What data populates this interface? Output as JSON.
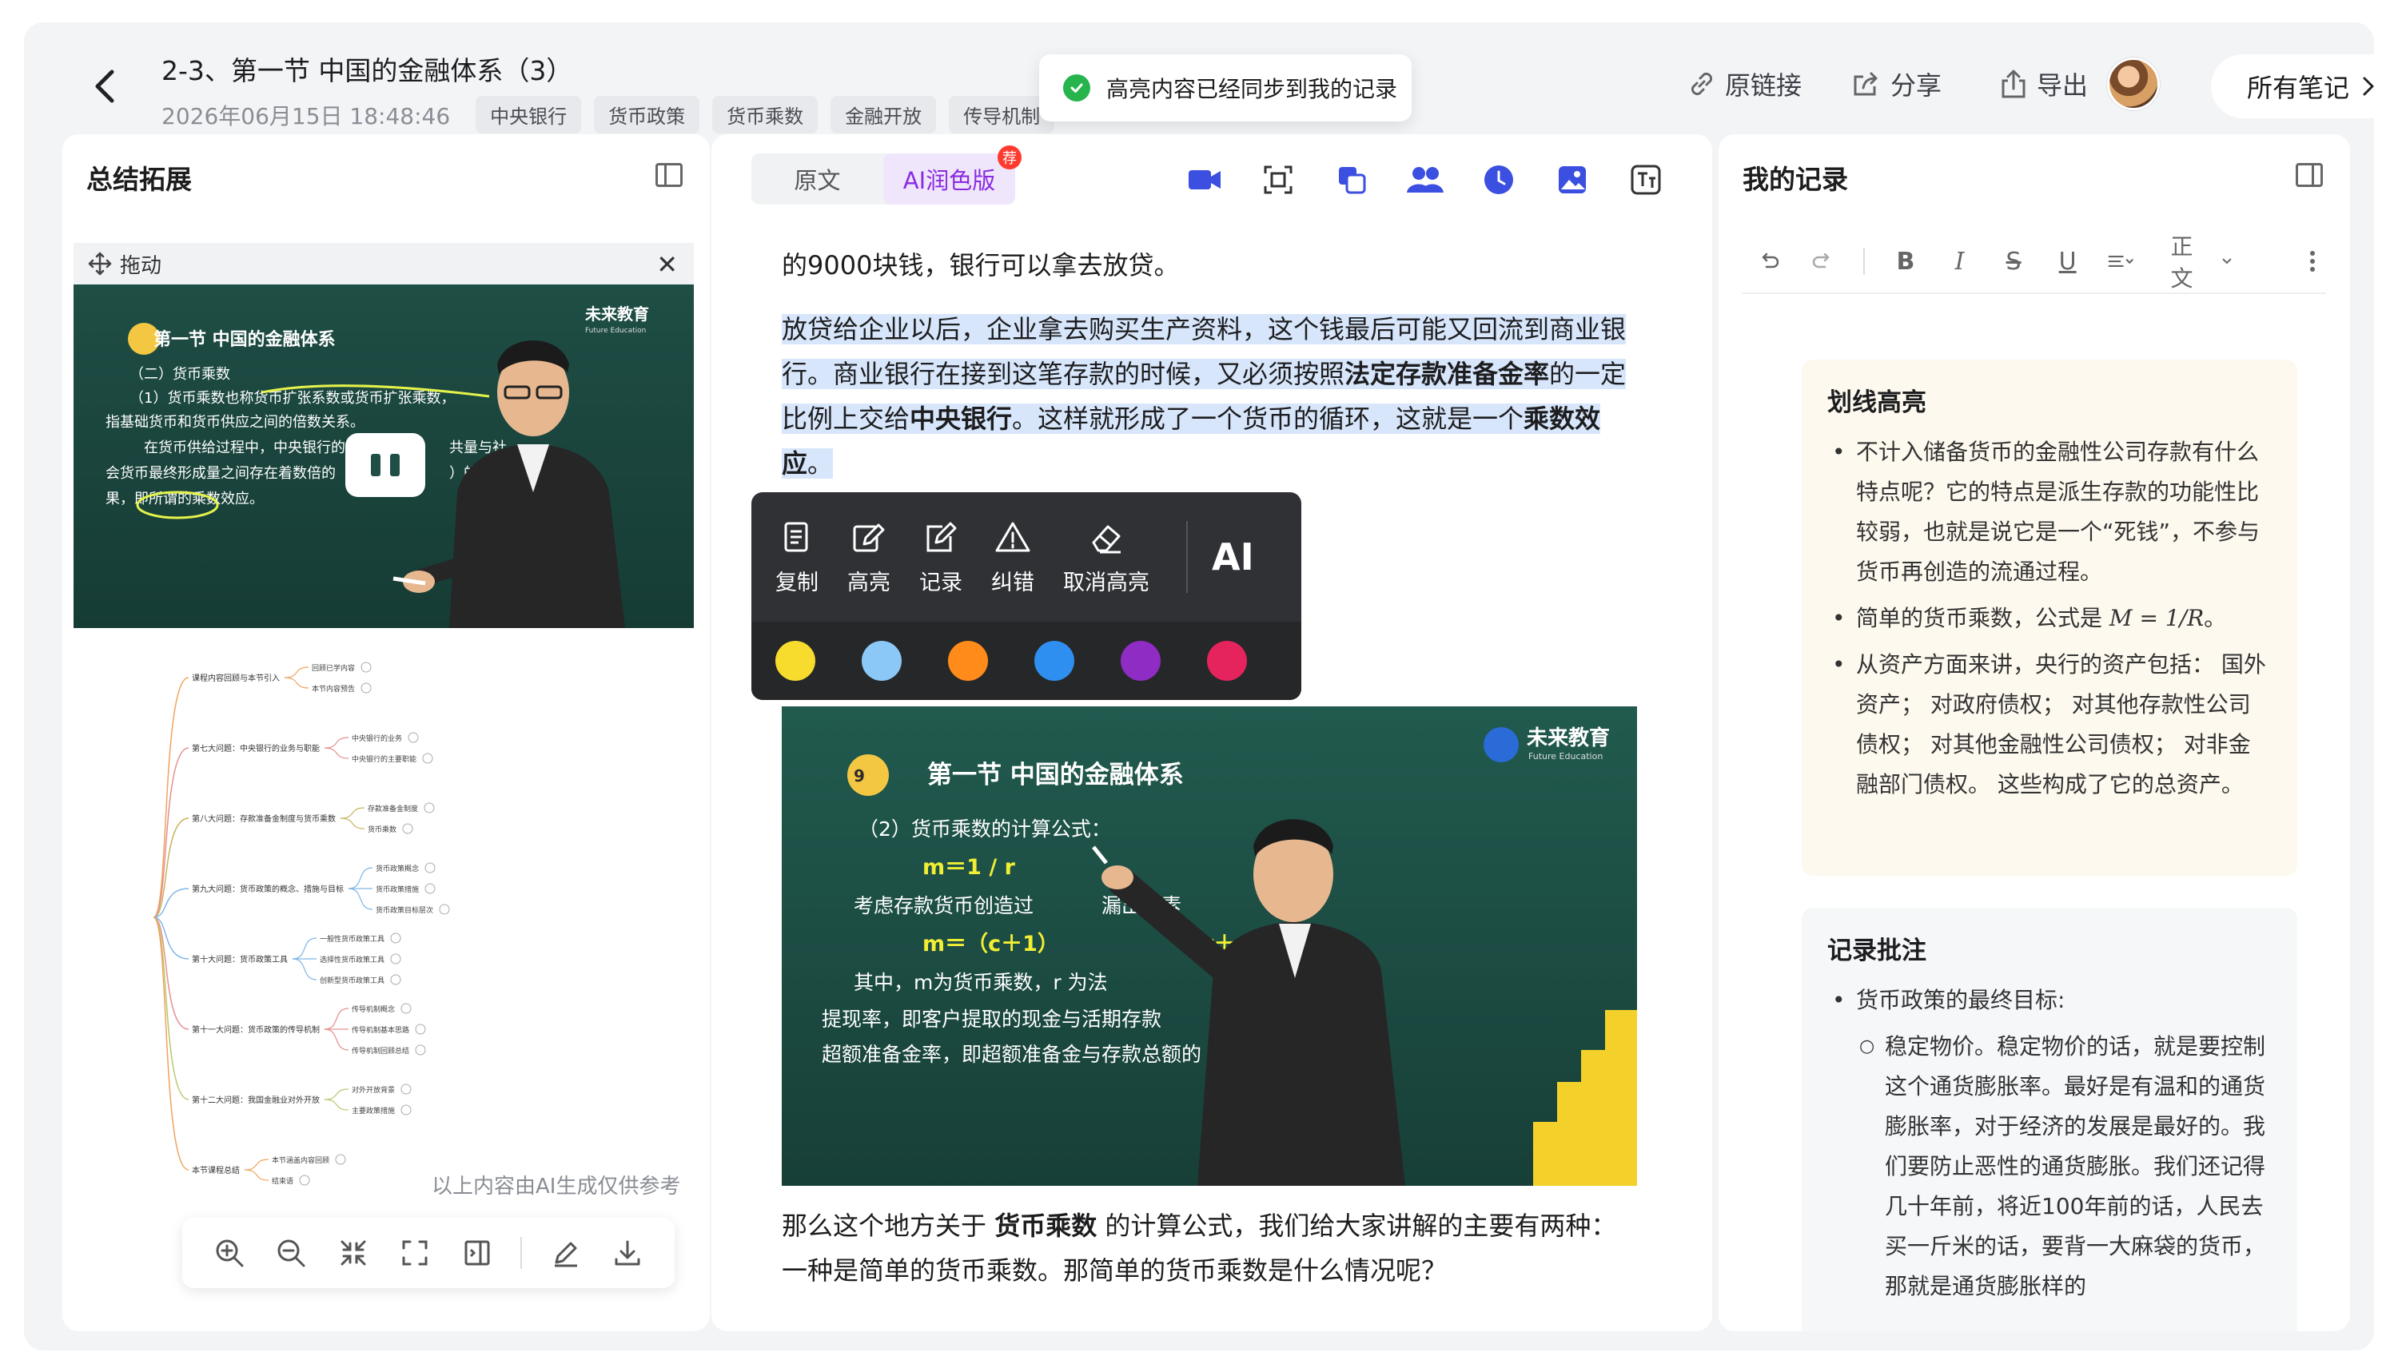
{
  "header": {
    "title": "2-3、第一节 中国的金融体系（3）",
    "date": "2026年06月15日 18:48:46",
    "tags": [
      "中央银行",
      "货币政策",
      "货币乘数",
      "金融开放",
      "传导机制"
    ],
    "toast": "高亮内容已经同步到我的记录",
    "link_label": "原链接",
    "share_label": "分享",
    "export_label": "导出",
    "all_notes_label": "所有笔记"
  },
  "left": {
    "title": "总结拓展",
    "drag_label": "拖动",
    "ai_note": "以上内容由AI生成仅供参考",
    "video": {
      "logo": "未来教育",
      "logo_sub": "Future Education",
      "heading": "第一节 中国的金融体系",
      "lines": [
        "（二）货币乘数",
        "（1）货币乘数也称货币扩张系数或货币扩张乘数，",
        "指基础货币和货币供应之间的倍数关系。",
        "在货币供给过程中，中央银行的",
        "会货币最终形成量之间存在着数倍的",
        "果，即所谓的乘数效应。",
        "共量与社",
        "）的效"
      ]
    },
    "mindmap": {
      "nodes": [
        {
          "label": "课程内容回顾与本节引入",
          "children": [
            "回顾已学内容",
            "本节内容预告"
          ]
        },
        {
          "label": "第七大问题：中央银行的业务与职能",
          "children": [
            "中央银行的业务",
            "中央银行的主要职能"
          ]
        },
        {
          "label": "第八大问题：存款准备金制度与货币乘数",
          "children": [
            "存款准备金制度",
            "货币乘数"
          ]
        },
        {
          "label": "第九大问题：货币政策的概念、措施与目标",
          "children": [
            "货币政策概念",
            "货币政策措施",
            "货币政策目标层次"
          ]
        },
        {
          "label": "第十大问题：货币政策工具",
          "children": [
            "一般性货币政策工具",
            "选择性货币政策工具",
            "创新型货币政策工具"
          ]
        },
        {
          "label": "第十一大问题：货币政策的传导机制",
          "children": [
            "传导机制概念",
            "传导机制基本思路",
            "传导机制回顾总结"
          ]
        },
        {
          "label": "第十二大问题：我国金融业对外开放",
          "children": [
            "对外开放背景",
            "主要政策措施"
          ]
        },
        {
          "label": "本节课程总结",
          "children": [
            "本节涵盖内容回顾",
            "结束语"
          ]
        }
      ]
    }
  },
  "middle": {
    "tab_original": "原文",
    "tab_ai": "AI润色版",
    "badge": "荐",
    "para0": "的9000块钱，银行可以拿去放贷。",
    "para1": {
      "a": "放贷给企业以后，企业拿去购买生产资料，这个钱最后可能又回流到商业银行。商业银行在接到这笔存款的时候，又必须按照",
      "b1": "法定存款准备金率",
      "c": "的一定比例上交给",
      "b2": "中央银行",
      "d": "。这样就形成了一个货币的循环，这就是一个",
      "b3": "乘数效应",
      "e": "。"
    },
    "popup": {
      "copy": "复制",
      "highlight": "高亮",
      "record": "记录",
      "correct": "纠错",
      "unhighlight": "取消高亮",
      "ai": "AI",
      "colors": [
        "#f7dc2e",
        "#8cc8f7",
        "#ff8c1a",
        "#2f8ff0",
        "#8e2cc4",
        "#e5245e"
      ]
    },
    "video": {
      "logo": "未来教育",
      "logo_sub": "Future Education",
      "heading": "第一节 中国的金融体系",
      "line1": "（2）货币乘数的计算公式：",
      "line2": "m＝1 / r",
      "line3": "考虑存款货币创造过",
      "line3b": "漏出因素",
      "line4": "m＝（c＋1）",
      "line4b": "＋r＋e）",
      "line5": "其中，m为货币乘数，r 为法",
      "line6": "提现率，即客户提取的现金与活期存款",
      "line7": "超额准备金率，即超额准备金与存款总额的"
    },
    "para2": {
      "a": "那么这个地方关于 ",
      "b": "货币乘数",
      "c": " 的计算公式，我们给大家讲解的主要有两种：一种是简单的货币乘数。那简单的货币乘数是什么情况呢？"
    }
  },
  "right": {
    "title": "我的记录",
    "style_label": "正文",
    "card1": {
      "title": "划线高亮",
      "item1": "不计入储备货币的金融性公司存款有什么特点呢？它的特点是派生存款的功能性比较弱，也就是说它是一个“死钱”，不参与货币再创造的流通过程。",
      "item2_a": "简单的货币乘数，公式是 ",
      "item2_formula": "M = 1/R",
      "item2_b": "。",
      "item3": "从资产方面来讲，央行的资产包括： 国外资产； 对政府债权； 对其他存款性公司债权； 对其他金融性公司债权； 对非金融部门债权。 这些构成了它的总资产。"
    },
    "card2": {
      "title": "记录批注",
      "item1": "货币政策的最终目标:",
      "sub1": "稳定物价。稳定物价的话，就是要控制这个通货膨胀率。最好是有温和的通货膨胀率，对于经济的发展是最好的。我们要防止恶性的通货膨胀。我们还记得几十年前，将近100年前的话，人民去买一斤米的话，要背一大麻袋的货币，那就是通货膨胀样的"
    }
  }
}
